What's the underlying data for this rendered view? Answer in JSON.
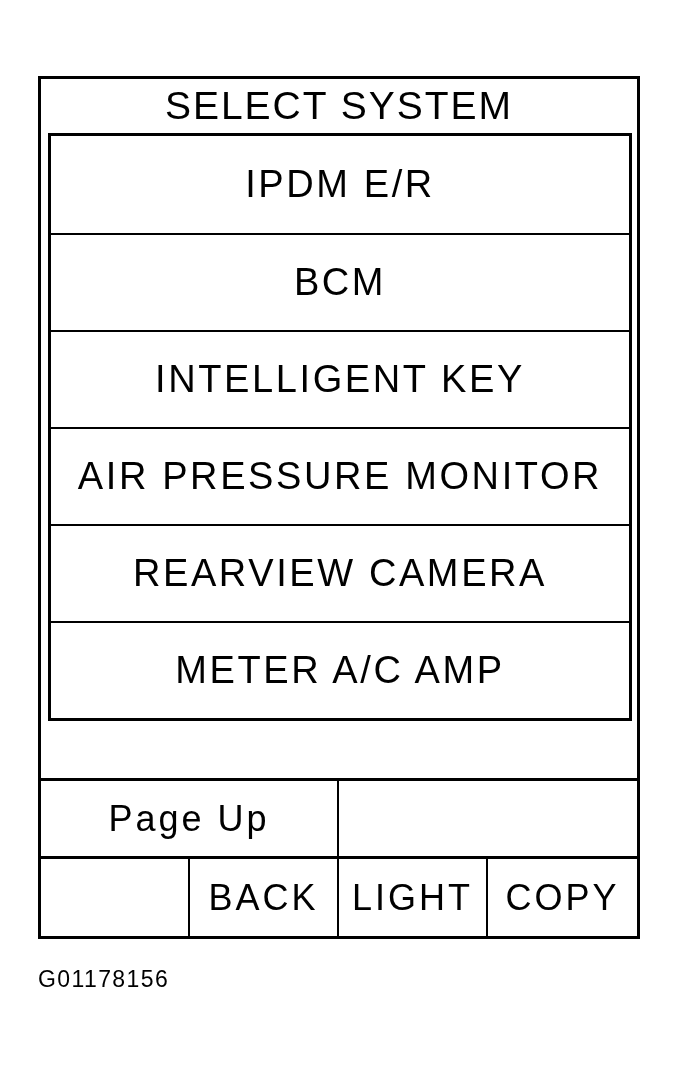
{
  "screen": {
    "title": "SELECT SYSTEM",
    "systems": [
      {
        "label": "IPDM E/R"
      },
      {
        "label": "BCM"
      },
      {
        "label": "INTELLIGENT KEY"
      },
      {
        "label": "AIR PRESSURE MONITOR"
      },
      {
        "label": "REARVIEW CAMERA"
      },
      {
        "label": "METER A/C AMP"
      }
    ],
    "key_rows": [
      {
        "cells": [
          {
            "kind": "key",
            "label": "Page Up"
          },
          {
            "kind": "blank"
          }
        ]
      },
      {
        "cells": [
          {
            "kind": "blank"
          },
          {
            "kind": "key",
            "label": "BACK"
          },
          {
            "kind": "key",
            "label": "LIGHT"
          },
          {
            "kind": "key",
            "label": "COPY"
          }
        ]
      }
    ]
  },
  "caption": "G01178156"
}
